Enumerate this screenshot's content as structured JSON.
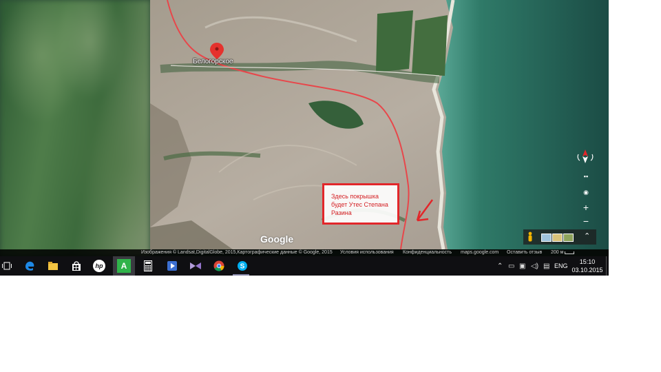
{
  "map": {
    "place_label": "Белогорское",
    "google_logo": "Google",
    "annotation_lines": [
      "Здесь покрышка",
      "будет Утес Степана",
      "Разина"
    ],
    "colors": {
      "annotation": "#e2262a",
      "route": "#e8464a",
      "sea": "#1f5e50"
    }
  },
  "attribution": {
    "imagery": "Изображения © Landsat,DigitalGlobe, 2015,Картографические данные © Google, 2015",
    "terms": "Условия использования",
    "privacy": "Конфиденциальность",
    "site": "maps.google.com",
    "feedback": "Оставить отзыв",
    "scale": "200 м"
  },
  "controls": {
    "zoom_in": "+",
    "zoom_out": "−",
    "expand": "⌃"
  },
  "taskbar": {
    "apps": [
      "task-view",
      "edge",
      "file-explorer",
      "store",
      "hp",
      "app-a",
      "calculator",
      "media-player",
      "visual-studio",
      "chrome",
      "skype"
    ],
    "app_a_letter": "A",
    "hp_label": "hp",
    "language": "ENG",
    "time": "15:10",
    "date": "03.10.2015"
  }
}
